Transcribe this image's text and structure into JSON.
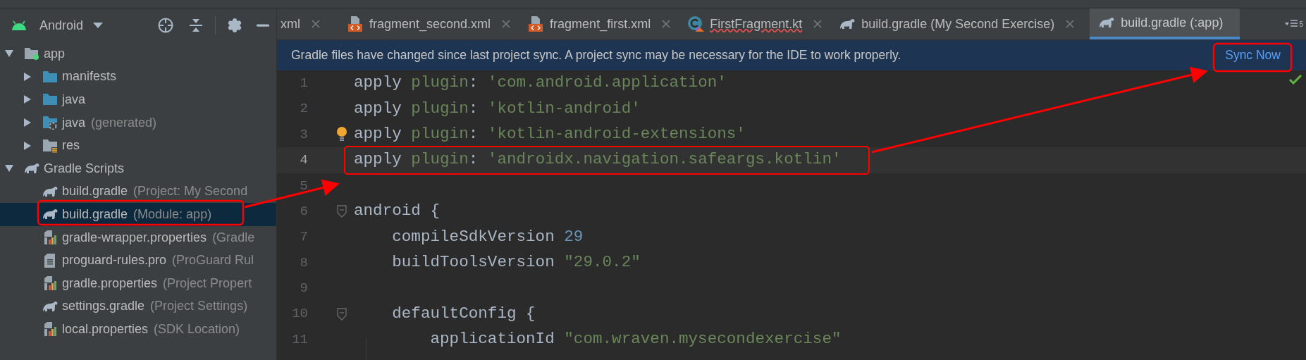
{
  "project_panel": {
    "view": "Android",
    "tree": [
      {
        "label": "app",
        "kind": "module",
        "expanded": true,
        "selected": false,
        "children": [
          {
            "label": "manifests",
            "kind": "folder",
            "expanded": false,
            "selected": false
          },
          {
            "label": "java",
            "kind": "folder",
            "expanded": false,
            "selected": false
          },
          {
            "label": "java",
            "hint": "(generated)",
            "kind": "folder-generated",
            "expanded": false,
            "selected": false
          },
          {
            "label": "res",
            "kind": "folder-res",
            "expanded": false,
            "selected": false
          }
        ]
      },
      {
        "label": "Gradle Scripts",
        "kind": "gradle",
        "expanded": true,
        "selected": false,
        "children": [
          {
            "label": "build.gradle",
            "hint": "(Project: My Second",
            "kind": "gradle",
            "selected": false
          },
          {
            "label": "build.gradle",
            "hint": "(Module: app)",
            "kind": "gradle",
            "selected": true
          },
          {
            "label": "gradle-wrapper.properties",
            "hint": "(Gradle",
            "kind": "properties",
            "selected": false
          },
          {
            "label": "proguard-rules.pro",
            "hint": "(ProGuard Rul",
            "kind": "file",
            "selected": false
          },
          {
            "label": "gradle.properties",
            "hint": "(Project Propert",
            "kind": "properties",
            "selected": false
          },
          {
            "label": "settings.gradle",
            "hint": "(Project Settings)",
            "kind": "gradle",
            "selected": false
          },
          {
            "label": "local.properties",
            "hint": "(SDK Location)",
            "kind": "properties",
            "selected": false
          }
        ]
      }
    ]
  },
  "tabs": [
    {
      "label": "xml",
      "kind": "plain",
      "selected": false,
      "error": false
    },
    {
      "label": "fragment_second.xml",
      "kind": "xml",
      "selected": false,
      "error": false
    },
    {
      "label": "fragment_first.xml",
      "kind": "xml",
      "selected": false,
      "error": false
    },
    {
      "label": "FirstFragment.kt",
      "kind": "kotlin",
      "selected": false,
      "error": true
    },
    {
      "label": "build.gradle (My Second Exercise)",
      "kind": "gradle",
      "selected": false,
      "error": false
    },
    {
      "label": "build.gradle (:app)",
      "kind": "gradle",
      "selected": true,
      "error": false
    }
  ],
  "tab_overflow_count": "5",
  "banner": {
    "message": "Gradle files have changed since last project sync. A project sync may be necessary for the IDE to work properly.",
    "action": "Sync Now"
  },
  "editor": {
    "lines": [
      {
        "number": "1",
        "current": false,
        "tokens": [
          {
            "kind": "plain",
            "text": "apply "
          },
          {
            "kind": "name",
            "text": "plugin"
          },
          {
            "kind": "plain",
            "text": ": "
          },
          {
            "kind": "string",
            "text": "'com.android.application'"
          }
        ]
      },
      {
        "number": "2",
        "current": false,
        "tokens": [
          {
            "kind": "plain",
            "text": "apply "
          },
          {
            "kind": "name",
            "text": "plugin"
          },
          {
            "kind": "plain",
            "text": ": "
          },
          {
            "kind": "string",
            "text": "'kotlin-android'"
          }
        ]
      },
      {
        "number": "3",
        "current": false,
        "bulb": true,
        "tokens": [
          {
            "kind": "plain",
            "text": "apply "
          },
          {
            "kind": "name",
            "text": "plugin"
          },
          {
            "kind": "plain",
            "text": ": "
          },
          {
            "kind": "string",
            "text": "'kotlin-android-extensions'"
          }
        ]
      },
      {
        "number": "4",
        "current": true,
        "boxed": true,
        "tokens": [
          {
            "kind": "plain",
            "text": "apply "
          },
          {
            "kind": "name",
            "text": "plugin"
          },
          {
            "kind": "plain",
            "text": ": "
          },
          {
            "kind": "string",
            "text": "'androidx.navigation.safeargs.kotlin'"
          }
        ]
      },
      {
        "number": "5",
        "current": false
      },
      {
        "number": "6",
        "current": false,
        "fold": true,
        "tokens": [
          {
            "kind": "plain",
            "text": "android {"
          }
        ]
      },
      {
        "number": "7",
        "current": false,
        "tokens": [
          {
            "kind": "plain",
            "text": "    compileSdkVersion "
          },
          {
            "kind": "number",
            "text": "29"
          }
        ]
      },
      {
        "number": "8",
        "current": false,
        "tokens": [
          {
            "kind": "plain",
            "text": "    buildToolsVersion "
          },
          {
            "kind": "string",
            "text": "\"29.0.2\""
          }
        ]
      },
      {
        "number": "9",
        "current": false
      },
      {
        "number": "10",
        "current": false,
        "fold": true,
        "tokens": [
          {
            "kind": "plain",
            "text": "    defaultConfig {"
          }
        ]
      },
      {
        "number": "11",
        "current": false,
        "tokens": [
          {
            "kind": "plain",
            "text": "        applicationId "
          },
          {
            "kind": "string",
            "text": "\"com.wraven.mysecondexercise\""
          }
        ]
      }
    ]
  }
}
